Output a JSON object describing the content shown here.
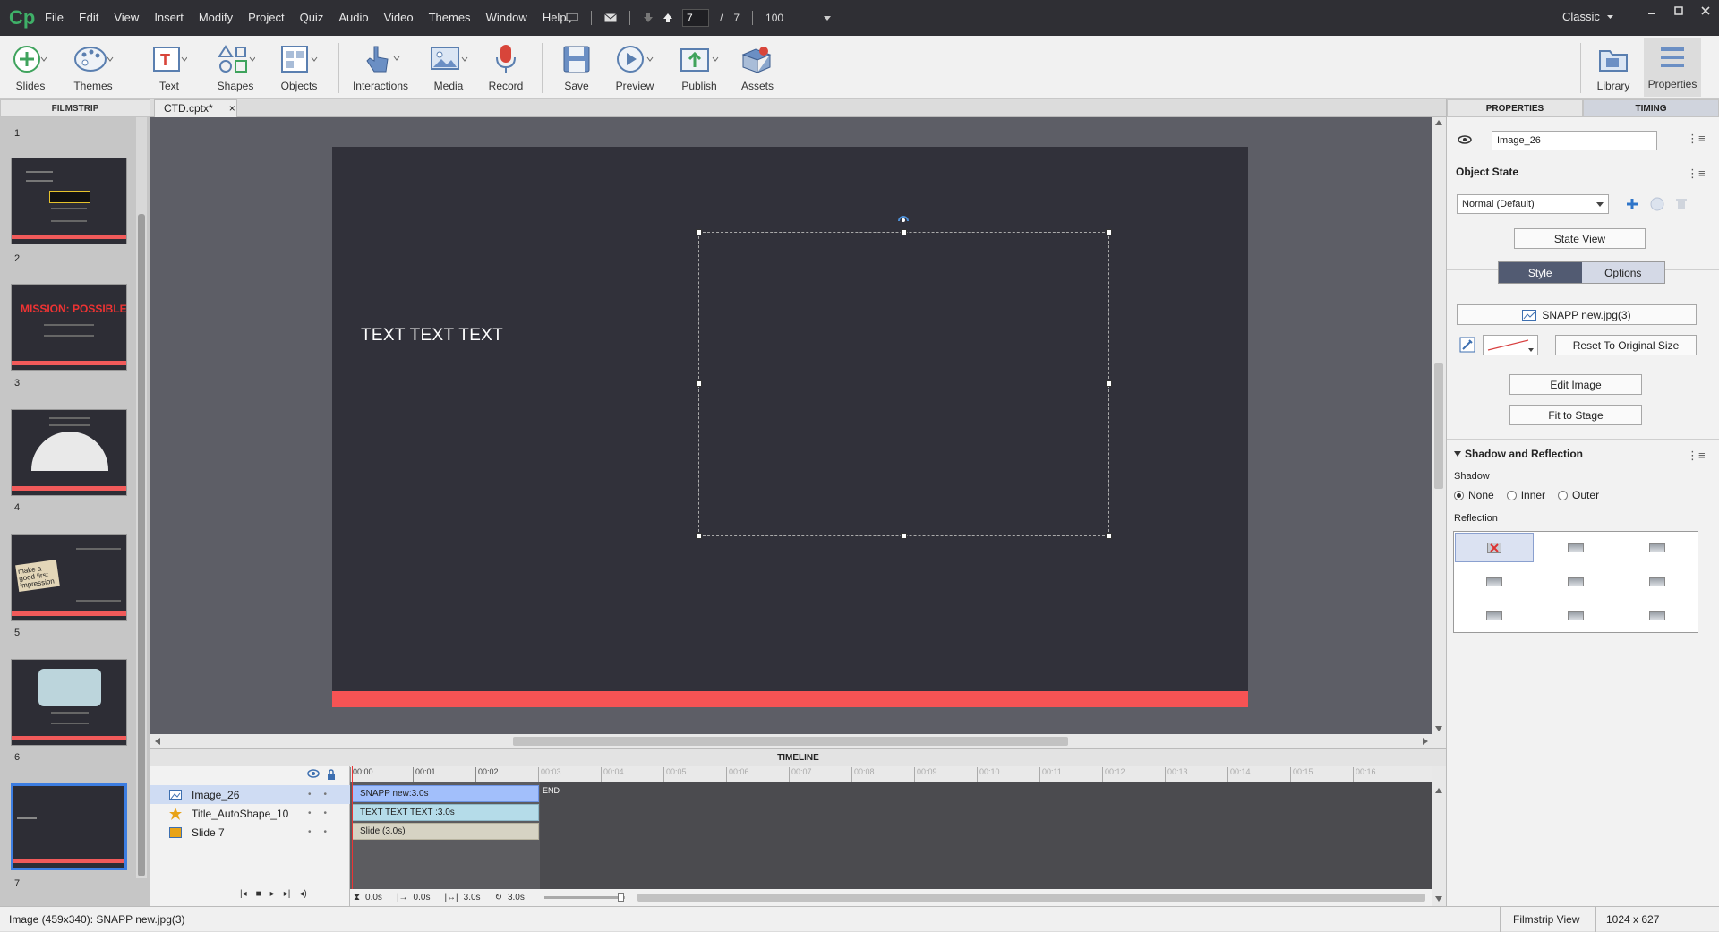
{
  "app": {
    "logo": "Cp"
  },
  "menu": [
    "File",
    "Edit",
    "View",
    "Insert",
    "Modify",
    "Project",
    "Quiz",
    "Audio",
    "Video",
    "Themes",
    "Window",
    "Help"
  ],
  "nav": {
    "current_page": "7",
    "separator": "/",
    "total_pages": "7",
    "zoom": "100"
  },
  "workspace": {
    "label": "Classic"
  },
  "toolbar": {
    "items": [
      {
        "label": "Slides",
        "icon": "plus-circle-icon"
      },
      {
        "label": "Themes",
        "icon": "palette-icon"
      },
      {
        "label": "Text",
        "icon": "text-icon"
      },
      {
        "label": "Shapes",
        "icon": "shapes-icon"
      },
      {
        "label": "Objects",
        "icon": "objects-icon"
      },
      {
        "label": "Interactions",
        "icon": "hand-pointer-icon"
      },
      {
        "label": "Media",
        "icon": "image-icon"
      },
      {
        "label": "Record",
        "icon": "microphone-icon"
      },
      {
        "label": "Save",
        "icon": "save-icon"
      },
      {
        "label": "Preview",
        "icon": "play-icon"
      },
      {
        "label": "Publish",
        "icon": "publish-icon"
      },
      {
        "label": "Assets",
        "icon": "assets-icon"
      }
    ],
    "right": [
      {
        "label": "Library",
        "icon": "folder-icon"
      },
      {
        "label": "Properties",
        "icon": "properties-icon"
      }
    ]
  },
  "filmstrip": {
    "header": "FILMSTRIP",
    "slides": [
      "1",
      "2",
      "3",
      "4",
      "5",
      "6",
      "7"
    ],
    "thumb_texts": [
      "MISSION: POSSIBLE",
      "make a good first impression"
    ]
  },
  "document": {
    "tab": "CTD.cptx*",
    "close": "×"
  },
  "slide": {
    "text": "TEXT TEXT TEXT",
    "accent": "#f55354",
    "bg": "#31313a"
  },
  "timeline": {
    "header": "TIMELINE",
    "layers": [
      {
        "name": "Image_26",
        "icon": "image-layer-icon"
      },
      {
        "name": "Title_AutoShape_10",
        "icon": "star-icon"
      },
      {
        "name": "Slide 7",
        "icon": "slide-icon"
      }
    ],
    "ruler": [
      "00:00",
      "00:01",
      "00:02",
      "00:03",
      "00:04",
      "00:05",
      "00:06",
      "00:07",
      "00:08",
      "00:09",
      "00:10",
      "00:11",
      "00:12",
      "00:13",
      "00:14",
      "00:15",
      "00:16"
    ],
    "tracks": [
      "SNAPP new:3.0s",
      "TEXT TEXT TEXT :3.0s",
      "Slide (3.0s)"
    ],
    "end": "END",
    "controls": {
      "current": "0.0s",
      "start": "0.0s",
      "duration": "3.0s",
      "loop": "3.0s"
    }
  },
  "properties": {
    "tabs": [
      "PROPERTIES",
      "TIMING"
    ],
    "name_value": "Image_26",
    "object_state_title": "Object State",
    "state_value": "Normal (Default)",
    "state_view": "State View",
    "style_tabs": [
      "Style",
      "Options"
    ],
    "image_button": "SNAPP new.jpg(3)",
    "reset_button": "Reset To Original Size",
    "edit_image": "Edit Image",
    "fit_to_stage": "Fit to Stage",
    "shadow_section": "Shadow and Reflection",
    "shadow_label": "Shadow",
    "shadow_options": [
      "None",
      "Inner",
      "Outer"
    ],
    "shadow_selected": "None",
    "reflection_label": "Reflection"
  },
  "status": {
    "left": "Image (459x340): SNAPP new.jpg(3)",
    "view": "Filmstrip View",
    "size": "1024 x 627"
  }
}
